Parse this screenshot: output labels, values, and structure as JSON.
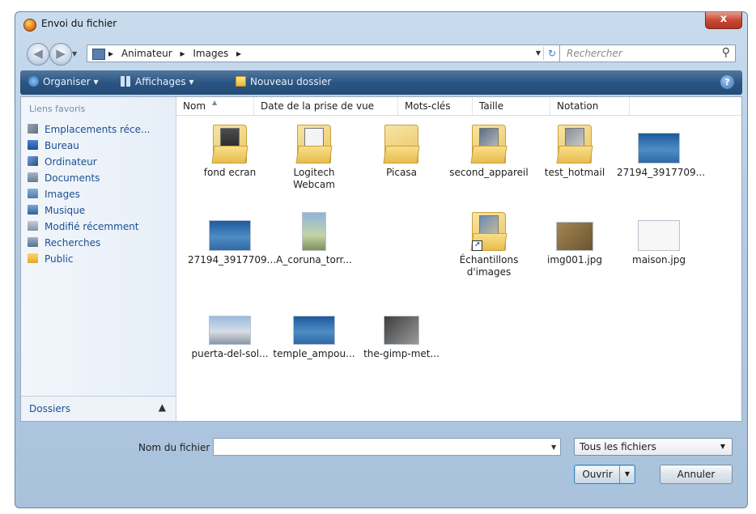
{
  "window": {
    "title": "Envoi du fichier",
    "close_glyph": "x"
  },
  "nav": {
    "breadcrumb": [
      "Animateur",
      "Images"
    ],
    "search_placeholder": "Rechercher"
  },
  "toolbar": {
    "organize": "Organiser",
    "views": "Affichages",
    "new_folder": "Nouveau dossier"
  },
  "sidebar": {
    "header": "Liens favoris",
    "items": [
      {
        "label": "Emplacements réce...",
        "icon": "recent-places-icon"
      },
      {
        "label": "Bureau",
        "icon": "desktop-icon"
      },
      {
        "label": "Ordinateur",
        "icon": "computer-icon"
      },
      {
        "label": "Documents",
        "icon": "documents-icon"
      },
      {
        "label": "Images",
        "icon": "pictures-icon"
      },
      {
        "label": "Musique",
        "icon": "music-icon"
      },
      {
        "label": "Modifié récemment",
        "icon": "recently-changed-icon"
      },
      {
        "label": "Recherches",
        "icon": "searches-icon"
      },
      {
        "label": "Public",
        "icon": "public-icon"
      }
    ],
    "folders_label": "Dossiers"
  },
  "columns": [
    "Nom",
    "Date de la prise de vue",
    "Mots-clés",
    "Taille",
    "Notation"
  ],
  "files": [
    {
      "name": "fond ecran",
      "kind": "folder"
    },
    {
      "name": "Logitech\nWebcam",
      "kind": "folder"
    },
    {
      "name": "Picasa",
      "kind": "folder"
    },
    {
      "name": "second_appareil",
      "kind": "folder"
    },
    {
      "name": "test_hotmail",
      "kind": "folder"
    },
    {
      "name": "27194_3917709...",
      "kind": "image"
    },
    {
      "name": "27194_3917709...",
      "kind": "image"
    },
    {
      "name": "A_coruna_torr...",
      "kind": "image"
    },
    {
      "name": "",
      "kind": "blank"
    },
    {
      "name": "Échantillons\nd'images",
      "kind": "shortcut-folder"
    },
    {
      "name": "img001.jpg",
      "kind": "image"
    },
    {
      "name": "maison.jpg",
      "kind": "image"
    },
    {
      "name": "puerta-del-sol...",
      "kind": "image"
    },
    {
      "name": "temple_ampou...",
      "kind": "image"
    },
    {
      "name": "the-gimp-met...",
      "kind": "image"
    }
  ],
  "footer": {
    "filename_label": "Nom du fichier :",
    "filename_value": "",
    "filetype": "Tous les fichiers",
    "open_button": "Ouvrir",
    "cancel_button": "Annuler"
  },
  "colors": {
    "toolbar": "#2b5583",
    "link": "#1b4f91",
    "close_button": "#c74a34"
  }
}
